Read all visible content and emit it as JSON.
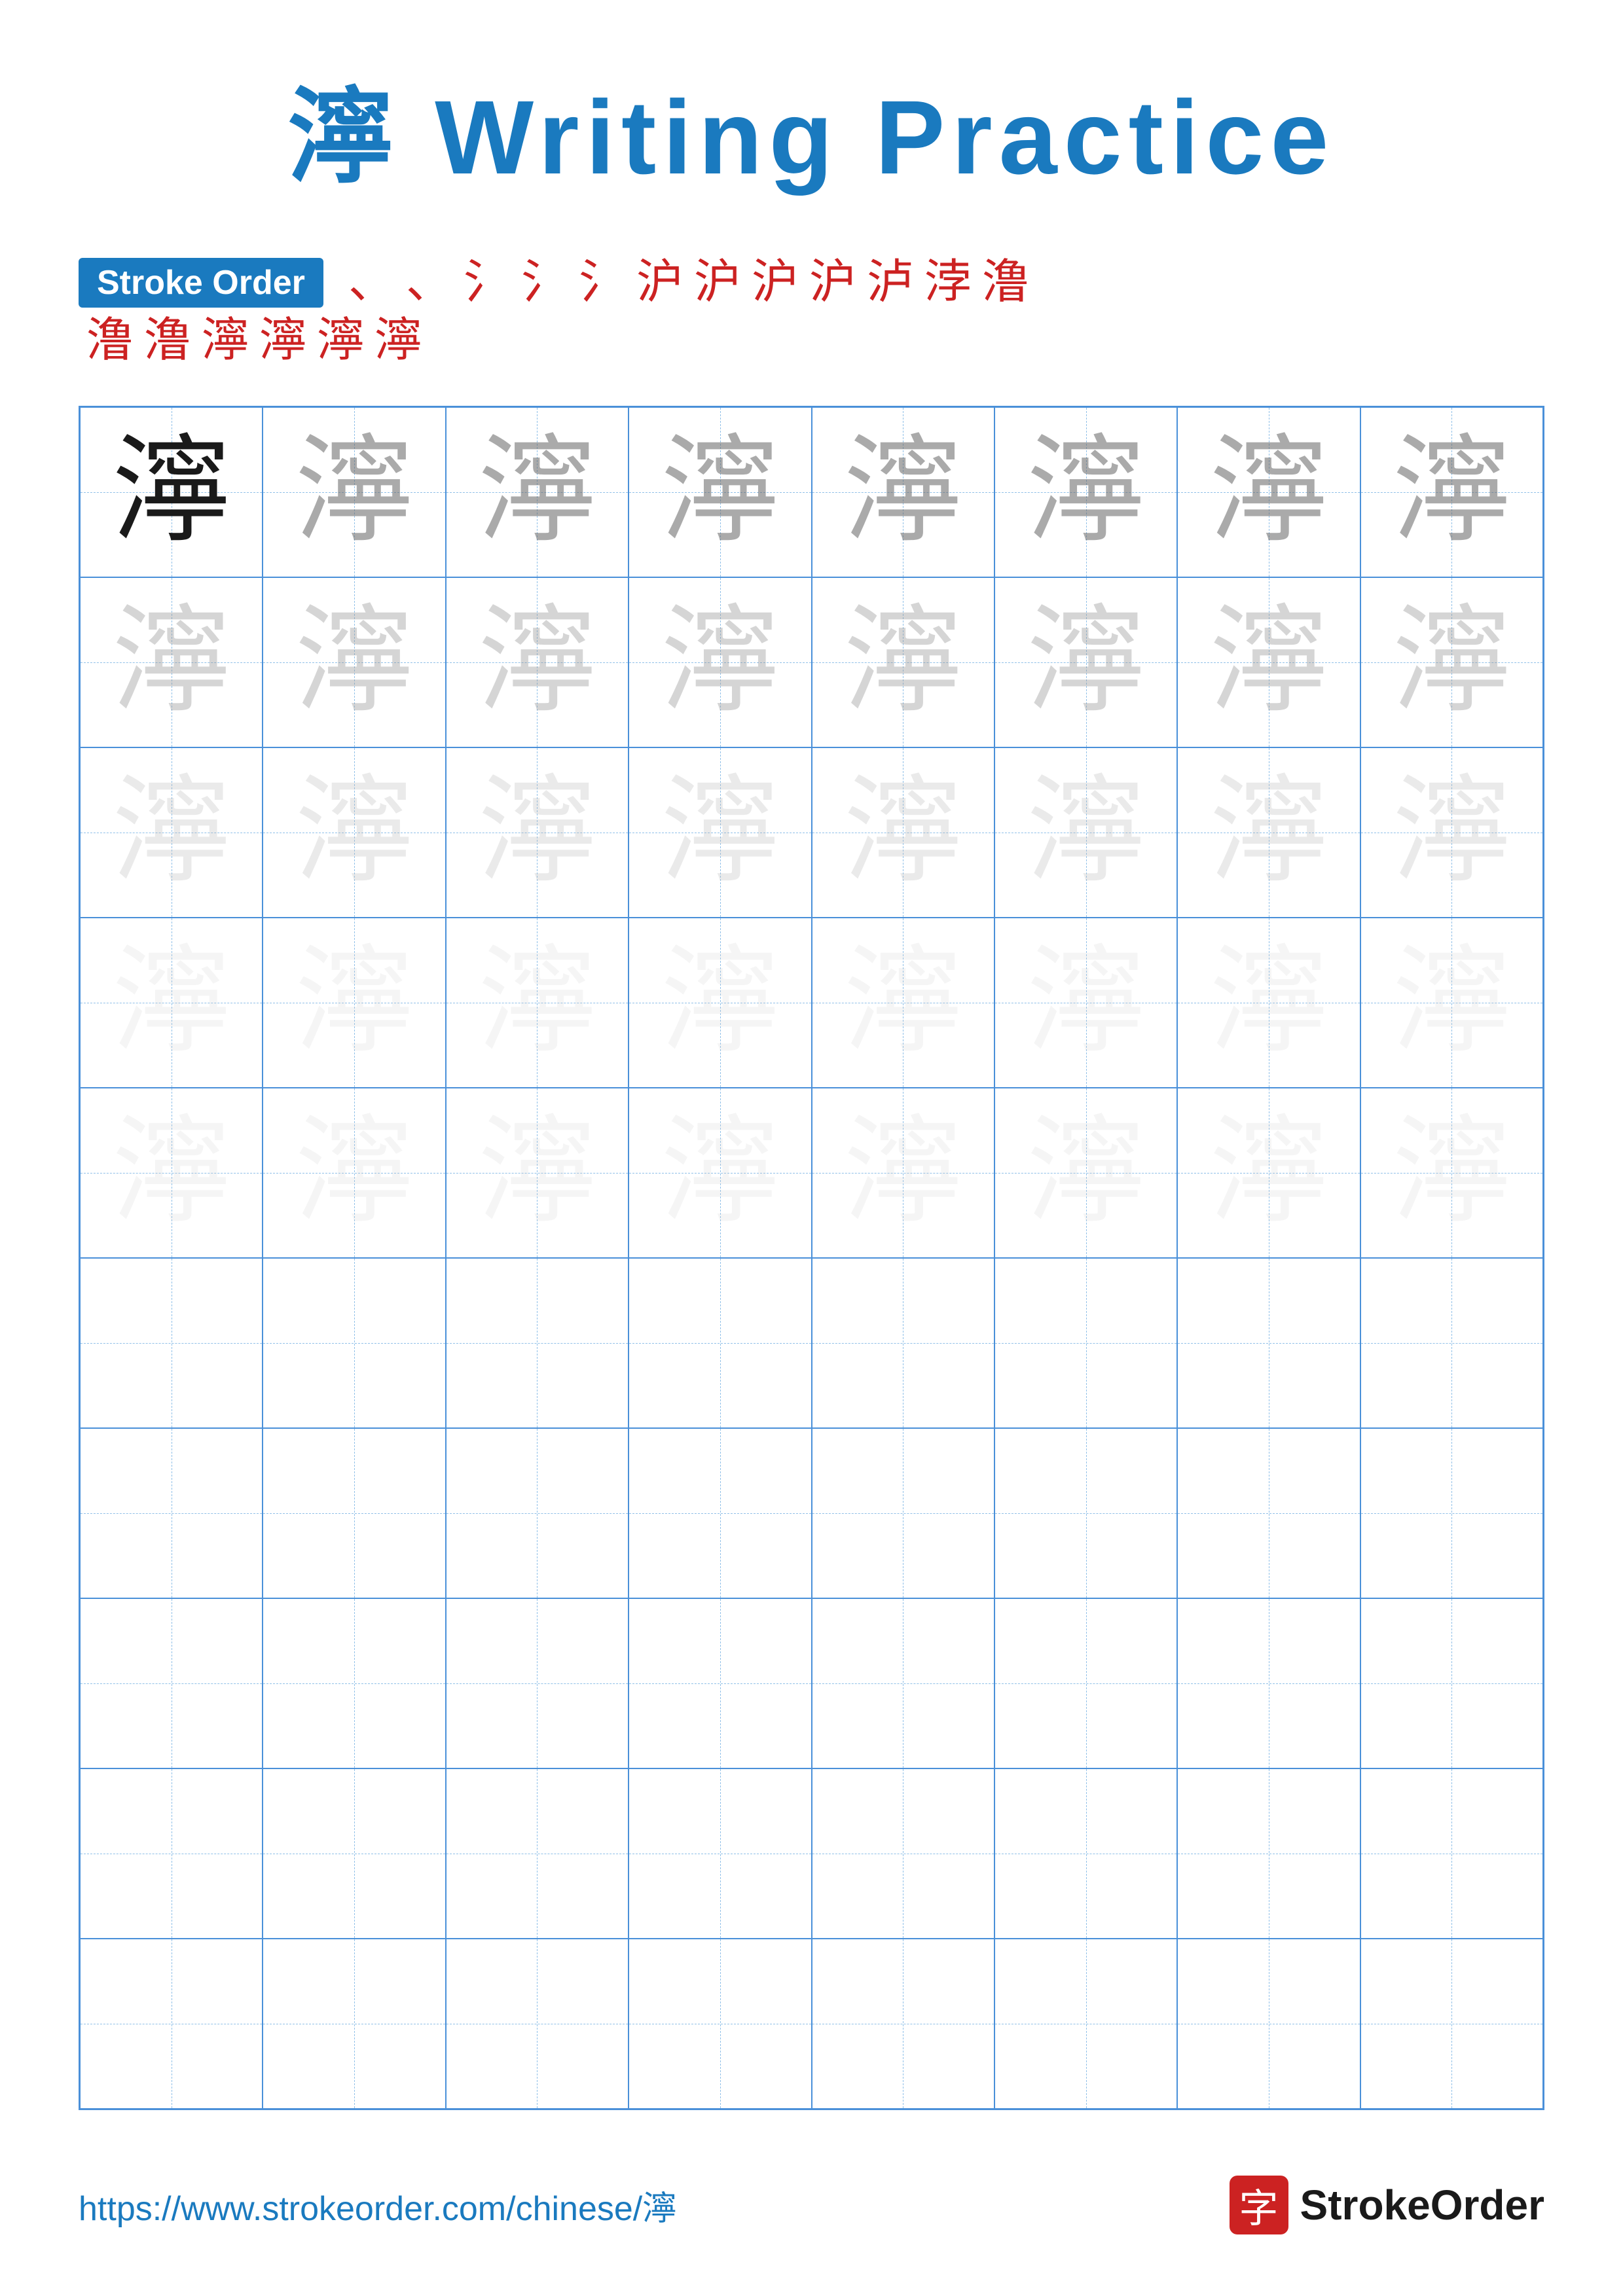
{
  "title": {
    "char": "濘",
    "text": " Writing Practice",
    "full": "濘 Writing Practice"
  },
  "stroke_order": {
    "badge_label": "Stroke Order",
    "strokes_row1": [
      "、",
      "、",
      "氵",
      "氵",
      "氵",
      "沪",
      "沪",
      "沪",
      "沪",
      "泸",
      "浡",
      "澛"
    ],
    "strokes_row2": [
      "澛",
      "澛",
      "濘",
      "濘",
      "濘",
      "濘"
    ]
  },
  "practice_char": "濘",
  "grid": {
    "cols": 8,
    "rows": 10,
    "practice_rows": 5
  },
  "footer": {
    "url": "https://www.strokeorder.com/chinese/濘",
    "logo_char": "字",
    "logo_text": "StrokeOrder"
  }
}
